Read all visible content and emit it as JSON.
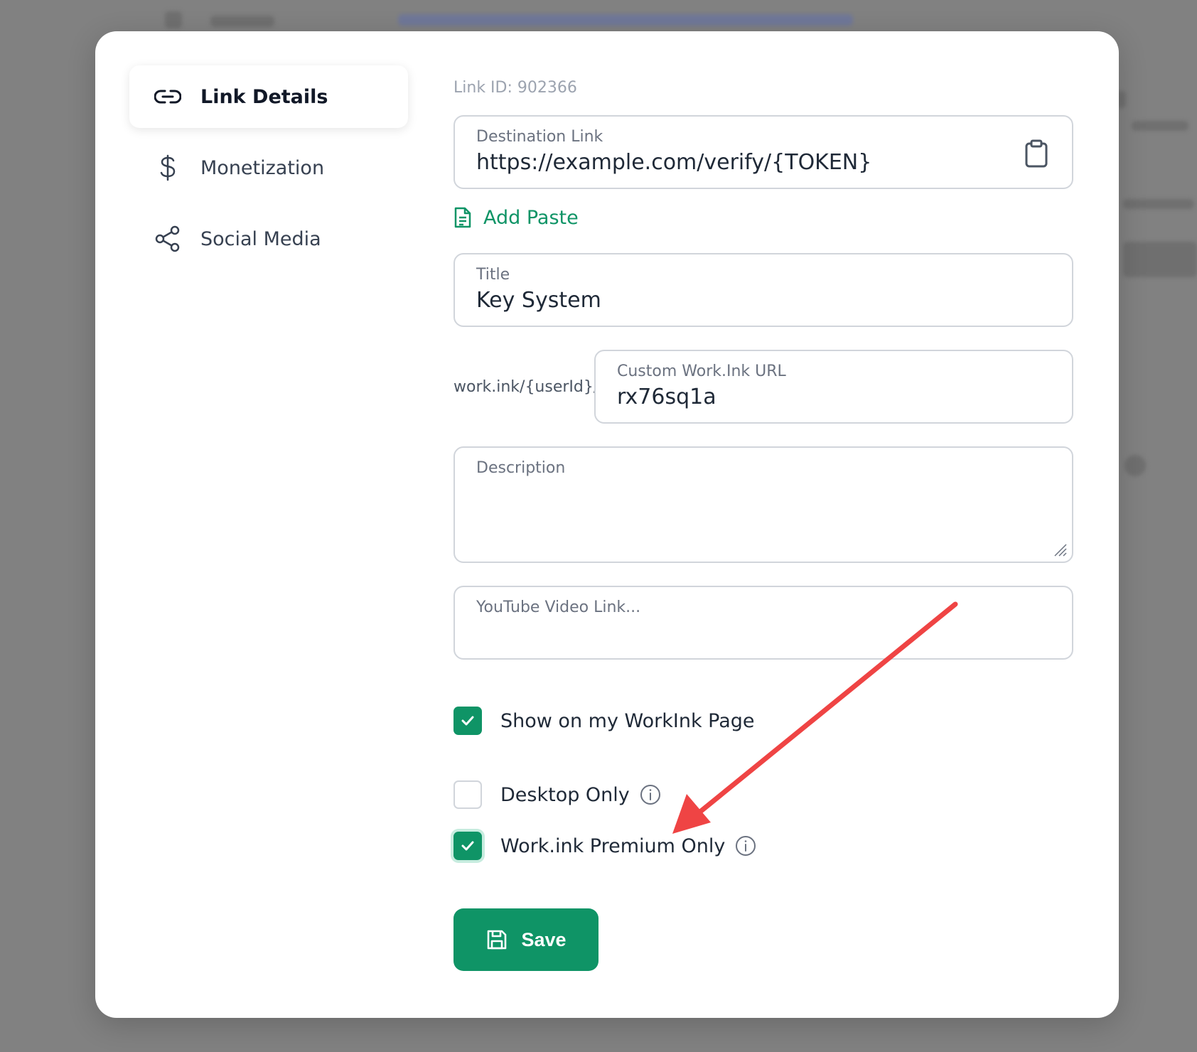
{
  "sidebar": {
    "items": [
      {
        "label": "Link Details",
        "icon": "link-icon",
        "active": true
      },
      {
        "label": "Monetization",
        "icon": "dollar-icon",
        "active": false
      },
      {
        "label": "Social Media",
        "icon": "share-icon",
        "active": false
      }
    ]
  },
  "form": {
    "link_id": "Link ID: 902366",
    "destination": {
      "label": "Destination Link",
      "value": "https://example.com/verify/{TOKEN}"
    },
    "add_paste_label": "Add Paste",
    "title": {
      "label": "Title",
      "value": "Key System"
    },
    "custom_url": {
      "prefix": "work.ink/{userId}/",
      "label": "Custom Work.Ink URL",
      "value": "rx76sq1a"
    },
    "description": {
      "placeholder": "Description",
      "value": ""
    },
    "youtube": {
      "placeholder": "YouTube Video Link...",
      "value": ""
    }
  },
  "options": {
    "show_on_page": {
      "label": "Show on my WorkInk Page",
      "checked": true
    },
    "desktop_only": {
      "label": "Desktop Only",
      "checked": false
    },
    "premium_only": {
      "label": "Work.ink Premium Only",
      "checked": true
    }
  },
  "save_label": "Save",
  "colors": {
    "accent": "#0f9466",
    "annotation_arrow": "#ef4444",
    "overlay": "#7b7b7b"
  }
}
